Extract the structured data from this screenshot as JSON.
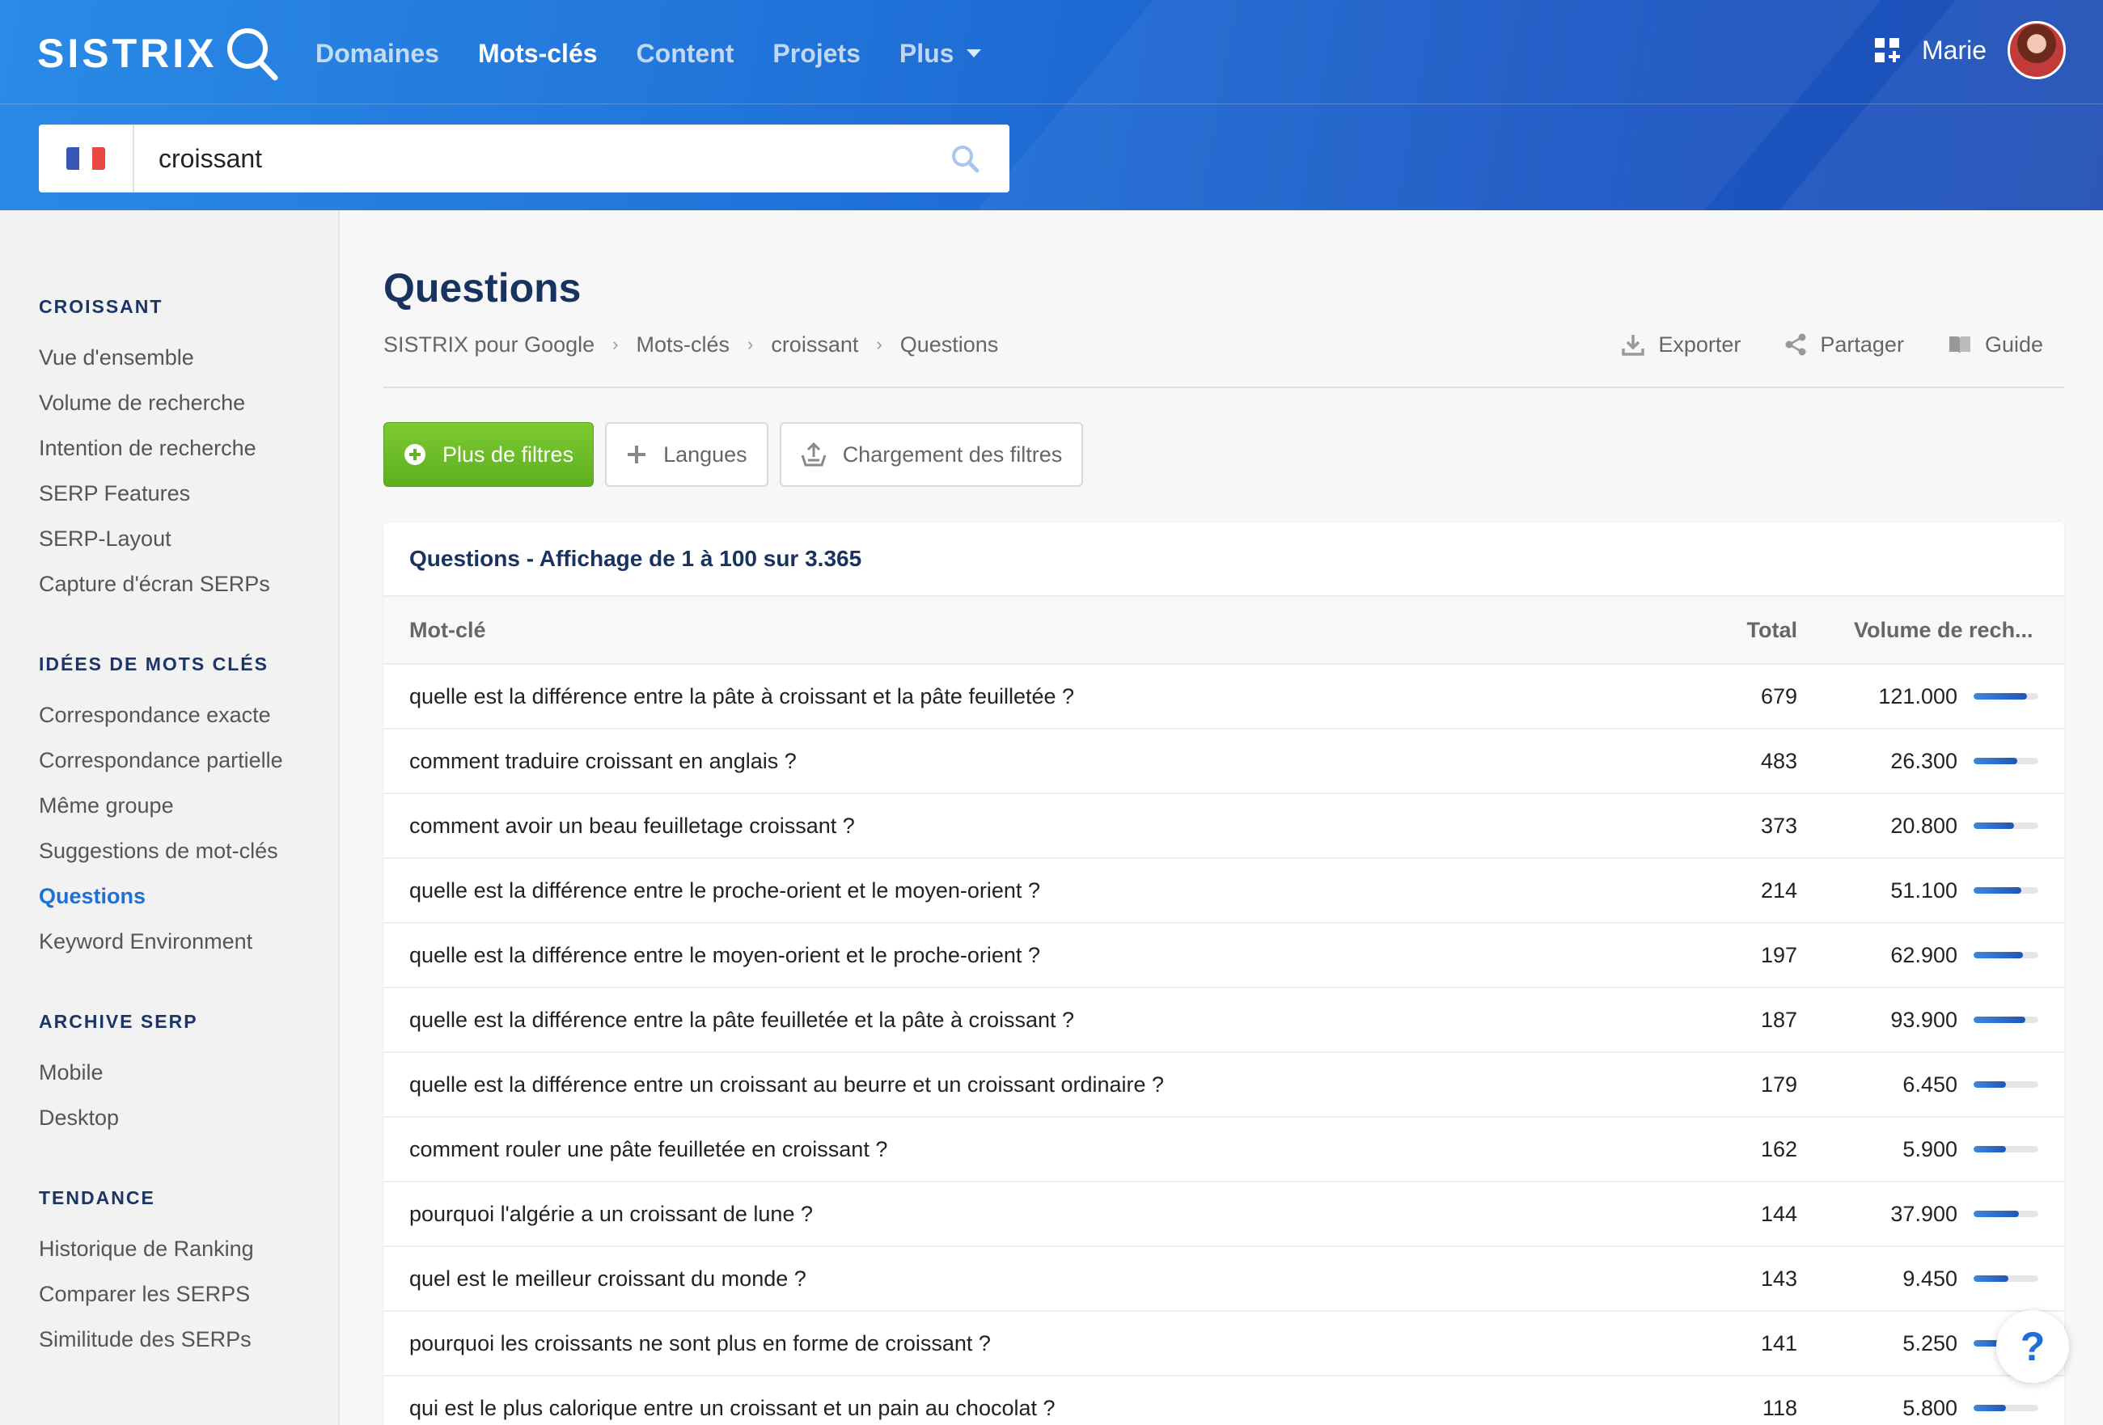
{
  "header": {
    "logo_text": "SISTRIX",
    "nav": [
      {
        "label": "Domaines",
        "active": false
      },
      {
        "label": "Mots-clés",
        "active": true
      },
      {
        "label": "Content",
        "active": false
      },
      {
        "label": "Projets",
        "active": false
      },
      {
        "label": "Plus",
        "active": false
      }
    ],
    "user_name": "Marie",
    "search_value": "croissant",
    "country_flag": "france-flag-icon"
  },
  "sidebar": {
    "sections": [
      {
        "title": "CROISSANT",
        "items": [
          "Vue d'ensemble",
          "Volume de recherche",
          "Intention de recherche",
          "SERP Features",
          "SERP-Layout",
          "Capture d'écran SERPs"
        ]
      },
      {
        "title": "IDÉES DE MOTS CLÉS",
        "items": [
          "Correspondance exacte",
          "Correspondance partielle",
          "Même groupe",
          "Suggestions de mot-clés",
          "Questions",
          "Keyword Environment"
        ]
      },
      {
        "title": "ARCHIVE SERP",
        "items": [
          "Mobile",
          "Desktop"
        ]
      },
      {
        "title": "TENDANCE",
        "items": [
          "Historique de Ranking",
          "Comparer les SERPS",
          "Similitude des SERPs"
        ]
      }
    ],
    "active_item": "Questions"
  },
  "main": {
    "title": "Questions",
    "breadcrumb": [
      "SISTRIX pour Google",
      "Mots-clés",
      "croissant",
      "Questions"
    ],
    "actions": {
      "export": "Exporter",
      "share": "Partager",
      "guide": "Guide"
    },
    "filters": {
      "more": "Plus de filtres",
      "languages": "Langues",
      "load": "Chargement des filtres"
    },
    "table": {
      "title": "Questions - Affichage de 1 à 100 sur 3.365",
      "columns": {
        "keyword": "Mot-clé",
        "total": "Total",
        "volume": "Volume de rech..."
      },
      "rows": [
        {
          "keyword": "quelle est la différence entre la pâte à croissant et la pâte feuilletée ?",
          "total": "679",
          "volume": "121.000",
          "bar": 0.82
        },
        {
          "keyword": "comment traduire croissant en anglais ?",
          "total": "483",
          "volume": "26.300",
          "bar": 0.68
        },
        {
          "keyword": "comment avoir un beau feuilletage croissant ?",
          "total": "373",
          "volume": "20.800",
          "bar": 0.62
        },
        {
          "keyword": "quelle est la différence entre le proche-orient et le moyen-orient ?",
          "total": "214",
          "volume": "51.100",
          "bar": 0.74
        },
        {
          "keyword": "quelle est la différence entre le moyen-orient et le proche-orient ?",
          "total": "197",
          "volume": "62.900",
          "bar": 0.76
        },
        {
          "keyword": "quelle est la différence entre la pâte feuilletée et la pâte à croissant ?",
          "total": "187",
          "volume": "93.900",
          "bar": 0.8
        },
        {
          "keyword": "quelle est la différence entre un croissant au beurre et un croissant ordinaire ?",
          "total": "179",
          "volume": "6.450",
          "bar": 0.5
        },
        {
          "keyword": "comment rouler une pâte feuilletée en croissant ?",
          "total": "162",
          "volume": "5.900",
          "bar": 0.5
        },
        {
          "keyword": "pourquoi l'algérie a un croissant de lune ?",
          "total": "144",
          "volume": "37.900",
          "bar": 0.7
        },
        {
          "keyword": "quel est le meilleur croissant du monde ?",
          "total": "143",
          "volume": "9.450",
          "bar": 0.54
        },
        {
          "keyword": "pourquoi les croissants ne sont plus en forme de croissant ?",
          "total": "141",
          "volume": "5.250",
          "bar": 0.48
        },
        {
          "keyword": "qui est le plus calorique entre un croissant et un pain au chocolat ?",
          "total": "118",
          "volume": "5.800",
          "bar": 0.5
        }
      ]
    }
  },
  "help_label": "?",
  "colors": {
    "brand": "#1f6fd6",
    "navy": "#18335f",
    "green": "#6cbc28"
  }
}
